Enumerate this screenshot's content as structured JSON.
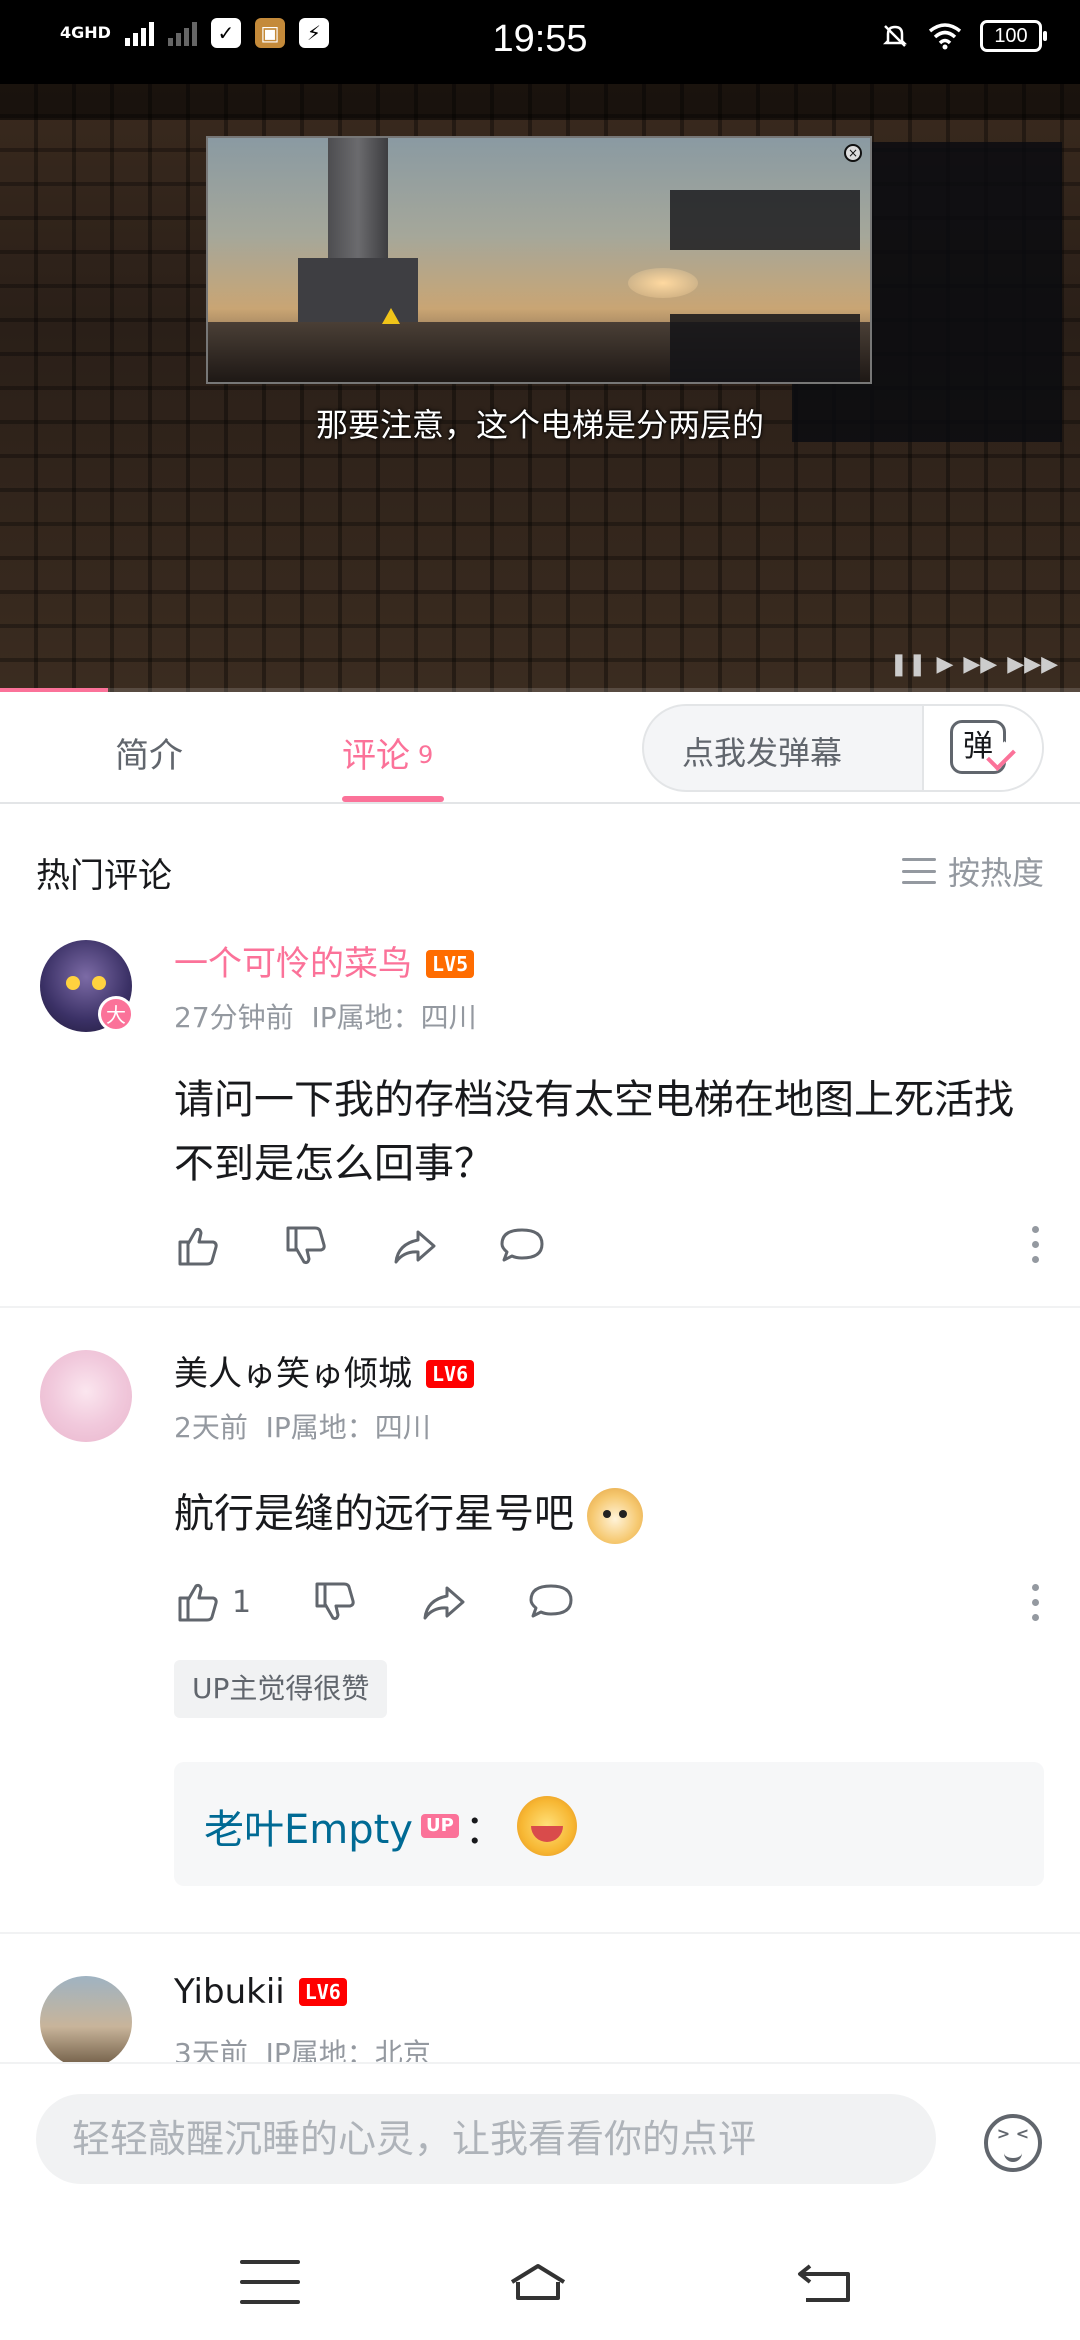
{
  "status_bar": {
    "network": "4GHD",
    "time": "19:55",
    "battery": "100"
  },
  "video": {
    "subtitle": "那要注意，这个电梯是分两层的",
    "progress_fraction": 0.1
  },
  "tabs": {
    "intro": "简介",
    "comments": "评论",
    "comments_count": "9",
    "danmaku_placeholder": "点我发弹幕",
    "danmaku_icon_char": "弹"
  },
  "comments_header": {
    "title": "热门评论",
    "sort_label": "按热度"
  },
  "comments": [
    {
      "username": "一个可怜的菜鸟",
      "level": "LV5",
      "avatar_badge": "大",
      "time": "27分钟前",
      "ip": "IP属地：四川",
      "text": "请问一下我的存档没有太空电梯在地图上死活找不到是怎么回事？",
      "likes": ""
    },
    {
      "username": "美人ゅ笑ゅ倾城",
      "level": "LV6",
      "time": "2天前",
      "ip": "IP属地：四川",
      "text": "航行是缝的远行星号吧",
      "likes": "1",
      "up_tag": "UP主觉得很赞",
      "reply": {
        "name": "老叶Empty",
        "badge": "UP",
        "colon": "："
      }
    },
    {
      "username": "Yibukii",
      "level": "LV6",
      "time": "3天前",
      "ip": "IP属地：北京"
    }
  ],
  "input": {
    "placeholder": "轻轻敲醒沉睡的心灵，让我看看你的点评"
  },
  "colors": {
    "brand_pink": "#fb7299",
    "reply_name_blue": "#006a94",
    "level5": "#ff6c00",
    "level6": "#ff0000"
  }
}
